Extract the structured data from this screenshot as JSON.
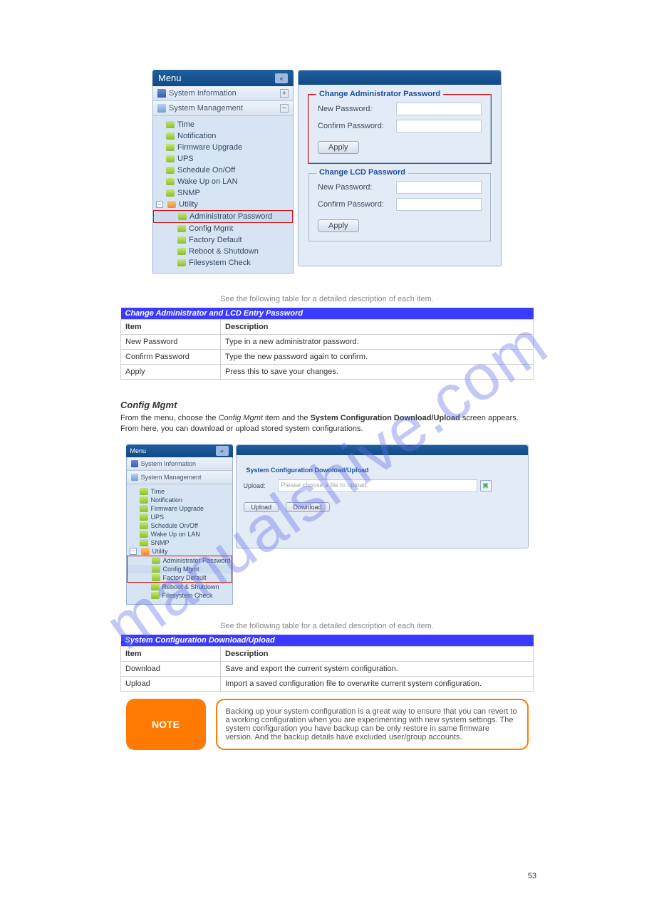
{
  "watermark": "manualshive.com",
  "shot1": {
    "menu_title": "Menu",
    "sec_info": "System Information",
    "sec_mgmt": "System Management",
    "tree": {
      "time": "Time",
      "notification": "Notification",
      "firmware": "Firmware Upgrade",
      "ups": "UPS",
      "schedule": "Schedule On/Off",
      "wol": "Wake Up on LAN",
      "snmp": "SNMP",
      "utility": "Utility",
      "adminpw": "Administrator Password",
      "config": "Config Mgmt",
      "factory": "Factory Default",
      "reboot": "Reboot & Shutdown",
      "fsck": "Filesystem Check"
    },
    "panel1": {
      "legend": "Change Administrator Password",
      "new_pw": "New Password:",
      "confirm_pw": "Confirm Password:",
      "apply": "Apply"
    },
    "panel2": {
      "legend": "Change LCD Password",
      "new_pw": "New Password:",
      "confirm_pw": "Confirm Password:",
      "apply": "Apply"
    }
  },
  "table1": {
    "header": "Change Administrator and LCD Entry Password",
    "rows": [
      {
        "k": "Item",
        "v": "Description"
      },
      {
        "k": "New Password",
        "v": "Type in a new administrator password."
      },
      {
        "k": "Confirm Password",
        "v": "Type the new password again to confirm."
      },
      {
        "k": "Apply",
        "v": "Press this to save your changes."
      }
    ]
  },
  "section_config": {
    "title": "Config Mgmt",
    "blurb_a": "From the menu, choose the ",
    "blurb_b": "Config Mgmt",
    "blurb_c": " item and the ",
    "blurb_d": "System Configuration Download/Upload",
    "blurb_e": " screen appears. From here, you can download or upload stored system configurations."
  },
  "shot2": {
    "menu_title": "Menu",
    "sec_info": "System Information",
    "sec_mgmt": "System Management",
    "tree": {
      "time": "Time",
      "notification": "Notification",
      "firmware": "Firmware Upgrade",
      "ups": "UPS",
      "schedule": "Schedule On/Off",
      "wol": "Wake Up on LAN",
      "snmp": "SNMP",
      "utility": "Utility",
      "adminpw": "Administrator Password",
      "config": "Config Mgmt",
      "factory": "Factory Default",
      "reboot": "Reboot & Shutdown",
      "fsck": "Filesystem Check"
    },
    "panel": {
      "legend": "System Configuration Download/Upload",
      "upload_label": "Upload:",
      "placeholder": "Please choose a file to upload.",
      "btn_upload": "Upload",
      "btn_download": "Download"
    }
  },
  "table2": {
    "header": "System Configuration Download/Upload",
    "rows": [
      {
        "k": "Item",
        "v": "Description"
      },
      {
        "k": "Download",
        "v": "Save and export the current system configuration."
      },
      {
        "k": "Upload",
        "v": "Import a saved configuration file to overwrite current system configuration."
      }
    ]
  },
  "note": {
    "tag": "NOTE",
    "text": "Backing up your system configuration is a great way to ensure that you can revert to a working configuration when you are experimenting with new system settings. The system configuration you have backup can be only restore in same firmware version. And the backup details have excluded user/group accounts."
  },
  "page_number": "53"
}
